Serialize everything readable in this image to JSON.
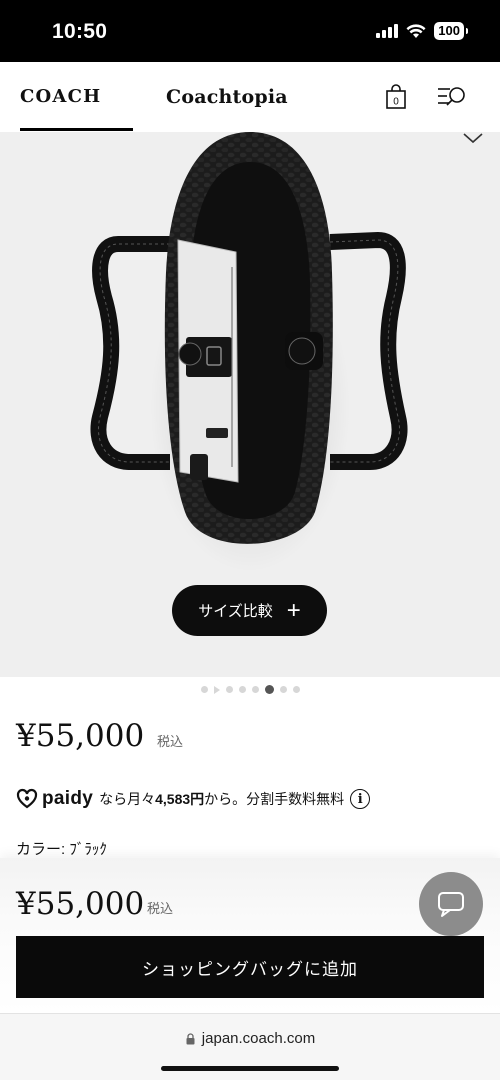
{
  "status_bar": {
    "time": "10:50",
    "battery": "100"
  },
  "header": {
    "brand": "COACH",
    "sub_brand": "Coachtopia",
    "bag_count": "0"
  },
  "product": {
    "size_compare_label": "サイズ比較",
    "carousel": {
      "total": 8,
      "active_index": 5
    },
    "price": "¥55,000",
    "tax_label": "税込",
    "paidy": {
      "logo": "paidy",
      "prefix": "なら月々",
      "monthly": "4,583円",
      "suffix": "から。分割手数料無料"
    },
    "color_label": "カラー: ﾌﾞﾗｯｸ"
  },
  "sticky_bar": {
    "price": "¥55,000",
    "tax_label": "税込",
    "add_to_bag_label": "ショッピングバッグに追加"
  },
  "browser": {
    "url": "japan.coach.com"
  },
  "colors": {
    "accent": "#000000",
    "image_bg": "#efefef",
    "chat_bg": "#8c8c8c"
  }
}
